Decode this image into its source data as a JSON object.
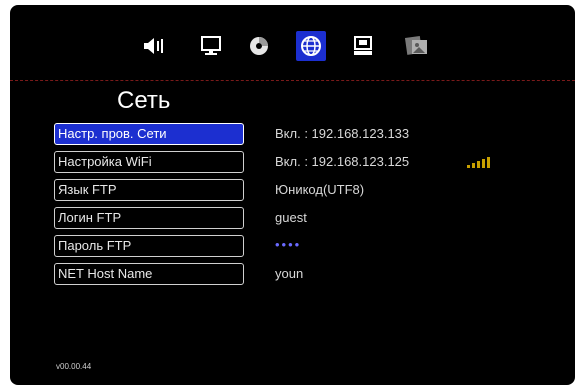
{
  "page": {
    "title": "Сеть",
    "version": "v00.00.44"
  },
  "toolbar": {
    "icons": [
      "speaker-icon",
      "monitor-icon",
      "disc-icon",
      "globe-icon",
      "server-icon",
      "photo-icon"
    ],
    "active_icon": "globe-icon"
  },
  "menu": {
    "items": [
      {
        "label": "Настр. пров. Сети",
        "value": "Вкл. : 192.168.123.133"
      },
      {
        "label": "Настройка WiFi",
        "value": "Вкл. : 192.168.123.125"
      },
      {
        "label": "Язык FTP",
        "value": "Юникод(UTF8)"
      },
      {
        "label": "Логин FTP",
        "value": "guest"
      },
      {
        "label": "Пароль FTP",
        "value": "••••"
      },
      {
        "label": "NET Host Name",
        "value": "youn"
      }
    ]
  },
  "colors": {
    "selection": "#1c2fd0",
    "signal": "#c8a000"
  }
}
